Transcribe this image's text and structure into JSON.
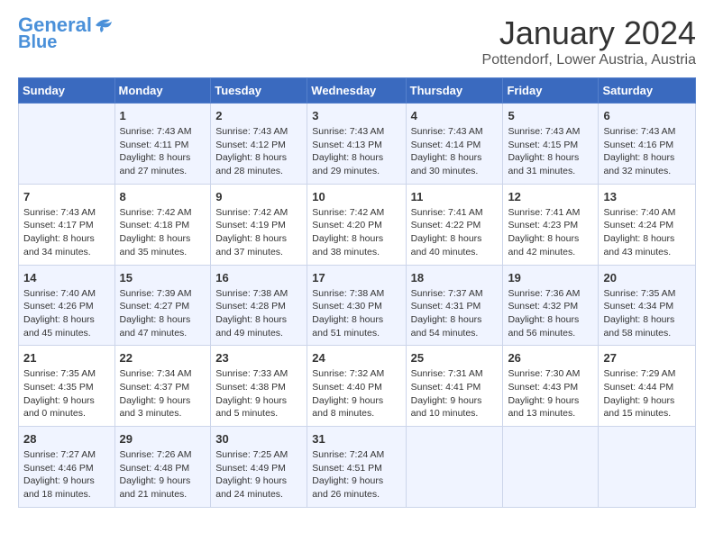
{
  "header": {
    "logo_line1": "General",
    "logo_line2": "Blue",
    "month": "January 2024",
    "location": "Pottendorf, Lower Austria, Austria"
  },
  "weekdays": [
    "Sunday",
    "Monday",
    "Tuesday",
    "Wednesday",
    "Thursday",
    "Friday",
    "Saturday"
  ],
  "weeks": [
    [
      {
        "day": "",
        "sunrise": "",
        "sunset": "",
        "daylight": ""
      },
      {
        "day": "1",
        "sunrise": "Sunrise: 7:43 AM",
        "sunset": "Sunset: 4:11 PM",
        "daylight": "Daylight: 8 hours and 27 minutes."
      },
      {
        "day": "2",
        "sunrise": "Sunrise: 7:43 AM",
        "sunset": "Sunset: 4:12 PM",
        "daylight": "Daylight: 8 hours and 28 minutes."
      },
      {
        "day": "3",
        "sunrise": "Sunrise: 7:43 AM",
        "sunset": "Sunset: 4:13 PM",
        "daylight": "Daylight: 8 hours and 29 minutes."
      },
      {
        "day": "4",
        "sunrise": "Sunrise: 7:43 AM",
        "sunset": "Sunset: 4:14 PM",
        "daylight": "Daylight: 8 hours and 30 minutes."
      },
      {
        "day": "5",
        "sunrise": "Sunrise: 7:43 AM",
        "sunset": "Sunset: 4:15 PM",
        "daylight": "Daylight: 8 hours and 31 minutes."
      },
      {
        "day": "6",
        "sunrise": "Sunrise: 7:43 AM",
        "sunset": "Sunset: 4:16 PM",
        "daylight": "Daylight: 8 hours and 32 minutes."
      }
    ],
    [
      {
        "day": "7",
        "sunrise": "Sunrise: 7:43 AM",
        "sunset": "Sunset: 4:17 PM",
        "daylight": "Daylight: 8 hours and 34 minutes."
      },
      {
        "day": "8",
        "sunrise": "Sunrise: 7:42 AM",
        "sunset": "Sunset: 4:18 PM",
        "daylight": "Daylight: 8 hours and 35 minutes."
      },
      {
        "day": "9",
        "sunrise": "Sunrise: 7:42 AM",
        "sunset": "Sunset: 4:19 PM",
        "daylight": "Daylight: 8 hours and 37 minutes."
      },
      {
        "day": "10",
        "sunrise": "Sunrise: 7:42 AM",
        "sunset": "Sunset: 4:20 PM",
        "daylight": "Daylight: 8 hours and 38 minutes."
      },
      {
        "day": "11",
        "sunrise": "Sunrise: 7:41 AM",
        "sunset": "Sunset: 4:22 PM",
        "daylight": "Daylight: 8 hours and 40 minutes."
      },
      {
        "day": "12",
        "sunrise": "Sunrise: 7:41 AM",
        "sunset": "Sunset: 4:23 PM",
        "daylight": "Daylight: 8 hours and 42 minutes."
      },
      {
        "day": "13",
        "sunrise": "Sunrise: 7:40 AM",
        "sunset": "Sunset: 4:24 PM",
        "daylight": "Daylight: 8 hours and 43 minutes."
      }
    ],
    [
      {
        "day": "14",
        "sunrise": "Sunrise: 7:40 AM",
        "sunset": "Sunset: 4:26 PM",
        "daylight": "Daylight: 8 hours and 45 minutes."
      },
      {
        "day": "15",
        "sunrise": "Sunrise: 7:39 AM",
        "sunset": "Sunset: 4:27 PM",
        "daylight": "Daylight: 8 hours and 47 minutes."
      },
      {
        "day": "16",
        "sunrise": "Sunrise: 7:38 AM",
        "sunset": "Sunset: 4:28 PM",
        "daylight": "Daylight: 8 hours and 49 minutes."
      },
      {
        "day": "17",
        "sunrise": "Sunrise: 7:38 AM",
        "sunset": "Sunset: 4:30 PM",
        "daylight": "Daylight: 8 hours and 51 minutes."
      },
      {
        "day": "18",
        "sunrise": "Sunrise: 7:37 AM",
        "sunset": "Sunset: 4:31 PM",
        "daylight": "Daylight: 8 hours and 54 minutes."
      },
      {
        "day": "19",
        "sunrise": "Sunrise: 7:36 AM",
        "sunset": "Sunset: 4:32 PM",
        "daylight": "Daylight: 8 hours and 56 minutes."
      },
      {
        "day": "20",
        "sunrise": "Sunrise: 7:35 AM",
        "sunset": "Sunset: 4:34 PM",
        "daylight": "Daylight: 8 hours and 58 minutes."
      }
    ],
    [
      {
        "day": "21",
        "sunrise": "Sunrise: 7:35 AM",
        "sunset": "Sunset: 4:35 PM",
        "daylight": "Daylight: 9 hours and 0 minutes."
      },
      {
        "day": "22",
        "sunrise": "Sunrise: 7:34 AM",
        "sunset": "Sunset: 4:37 PM",
        "daylight": "Daylight: 9 hours and 3 minutes."
      },
      {
        "day": "23",
        "sunrise": "Sunrise: 7:33 AM",
        "sunset": "Sunset: 4:38 PM",
        "daylight": "Daylight: 9 hours and 5 minutes."
      },
      {
        "day": "24",
        "sunrise": "Sunrise: 7:32 AM",
        "sunset": "Sunset: 4:40 PM",
        "daylight": "Daylight: 9 hours and 8 minutes."
      },
      {
        "day": "25",
        "sunrise": "Sunrise: 7:31 AM",
        "sunset": "Sunset: 4:41 PM",
        "daylight": "Daylight: 9 hours and 10 minutes."
      },
      {
        "day": "26",
        "sunrise": "Sunrise: 7:30 AM",
        "sunset": "Sunset: 4:43 PM",
        "daylight": "Daylight: 9 hours and 13 minutes."
      },
      {
        "day": "27",
        "sunrise": "Sunrise: 7:29 AM",
        "sunset": "Sunset: 4:44 PM",
        "daylight": "Daylight: 9 hours and 15 minutes."
      }
    ],
    [
      {
        "day": "28",
        "sunrise": "Sunrise: 7:27 AM",
        "sunset": "Sunset: 4:46 PM",
        "daylight": "Daylight: 9 hours and 18 minutes."
      },
      {
        "day": "29",
        "sunrise": "Sunrise: 7:26 AM",
        "sunset": "Sunset: 4:48 PM",
        "daylight": "Daylight: 9 hours and 21 minutes."
      },
      {
        "day": "30",
        "sunrise": "Sunrise: 7:25 AM",
        "sunset": "Sunset: 4:49 PM",
        "daylight": "Daylight: 9 hours and 24 minutes."
      },
      {
        "day": "31",
        "sunrise": "Sunrise: 7:24 AM",
        "sunset": "Sunset: 4:51 PM",
        "daylight": "Daylight: 9 hours and 26 minutes."
      },
      {
        "day": "",
        "sunrise": "",
        "sunset": "",
        "daylight": ""
      },
      {
        "day": "",
        "sunrise": "",
        "sunset": "",
        "daylight": ""
      },
      {
        "day": "",
        "sunrise": "",
        "sunset": "",
        "daylight": ""
      }
    ]
  ]
}
